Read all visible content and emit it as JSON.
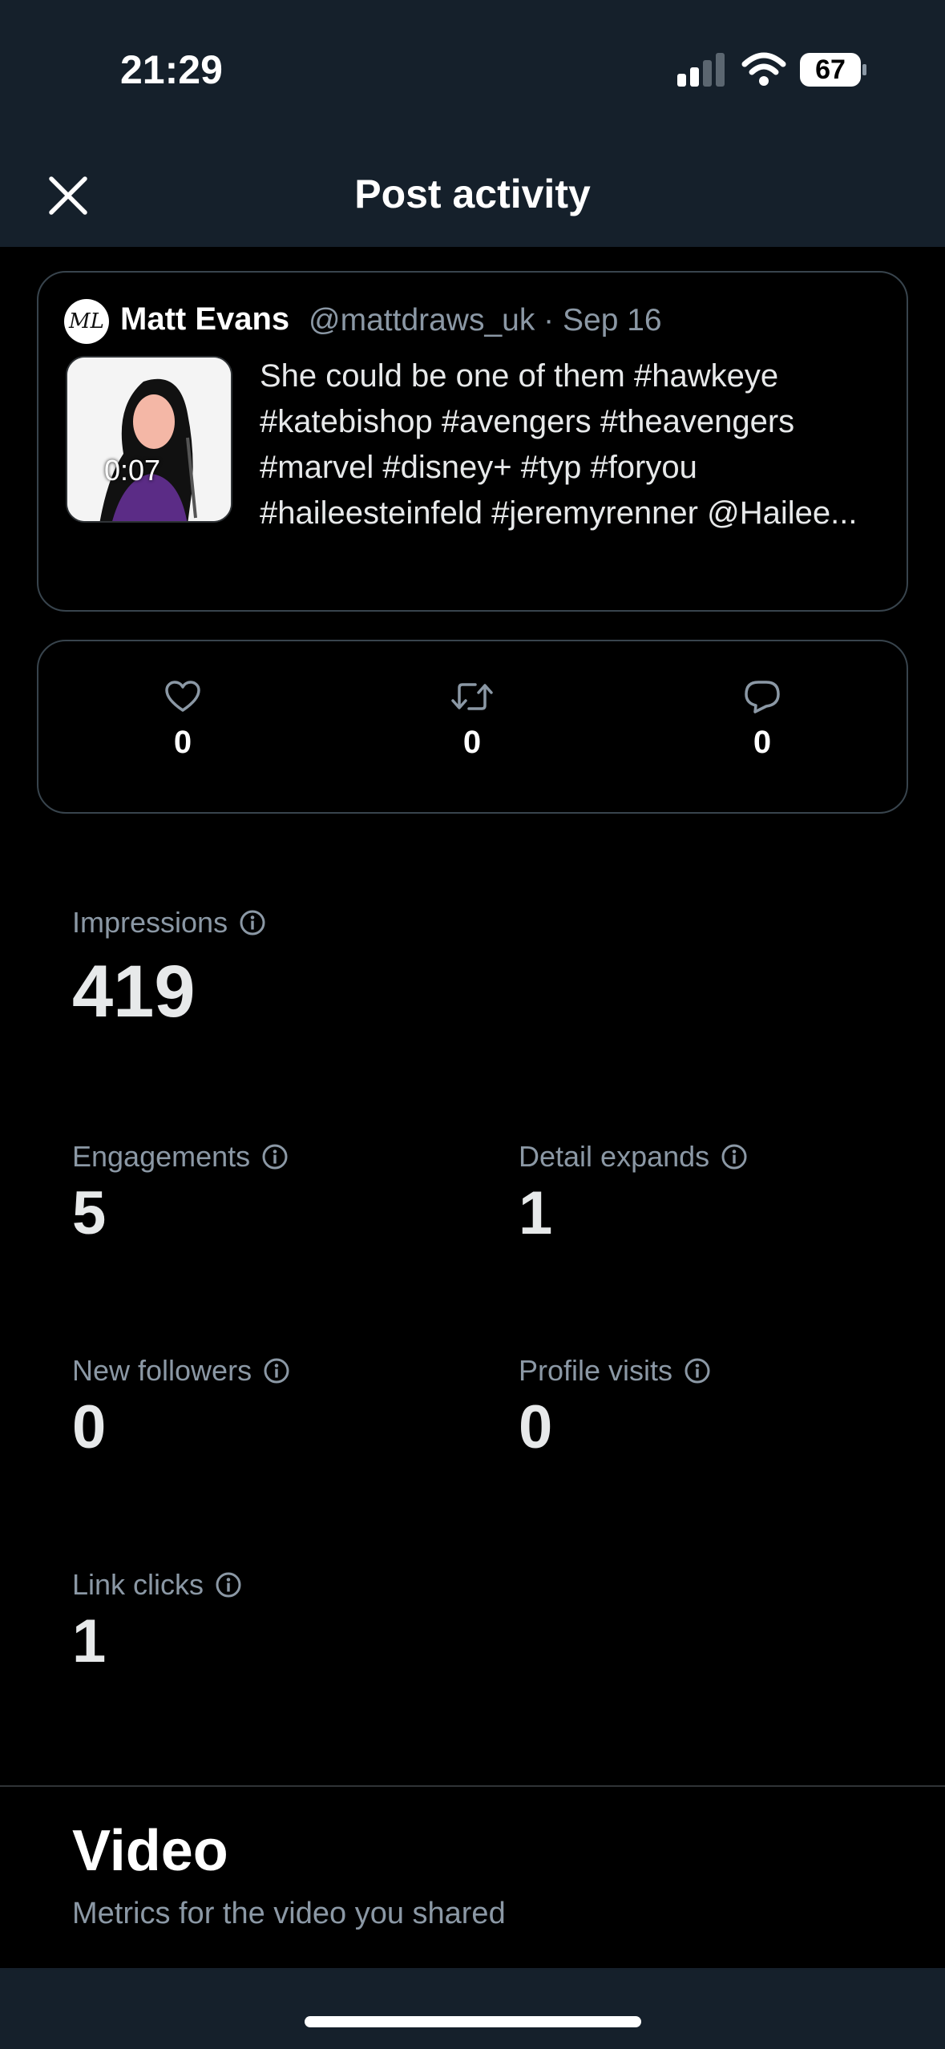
{
  "status_bar": {
    "time": "21:29",
    "battery": "67"
  },
  "header": {
    "title": "Post activity",
    "close_icon": "close-icon"
  },
  "post": {
    "author_name": "Matt Evans",
    "handle_date": "@mattdraws_uk · Sep 16",
    "video_duration": "0:07",
    "text": "She could be one of them #hawkeye #katebishop #avengers #theavengers #marvel #disney+ #typ #foryou #haileesteinfeld #jeremyrenner @Hailee...",
    "avatar_initials": "ML"
  },
  "engagement_counts": {
    "likes": "0",
    "reposts": "0",
    "replies": "0"
  },
  "metrics": {
    "impressions": {
      "label": "Impressions",
      "value": "419"
    },
    "engagements": {
      "label": "Engagements",
      "value": "5"
    },
    "detail_expands": {
      "label": "Detail expands",
      "value": "1"
    },
    "new_followers": {
      "label": "New followers",
      "value": "0"
    },
    "profile_visits": {
      "label": "Profile visits",
      "value": "0"
    },
    "link_clicks": {
      "label": "Link clicks",
      "value": "1"
    }
  },
  "video_section": {
    "title": "Video",
    "subtitle": "Metrics for the video you shared"
  },
  "colors": {
    "background": "#000000",
    "bar_background": "#15202b",
    "muted_text": "#8b98a5",
    "border": "#38444d"
  }
}
